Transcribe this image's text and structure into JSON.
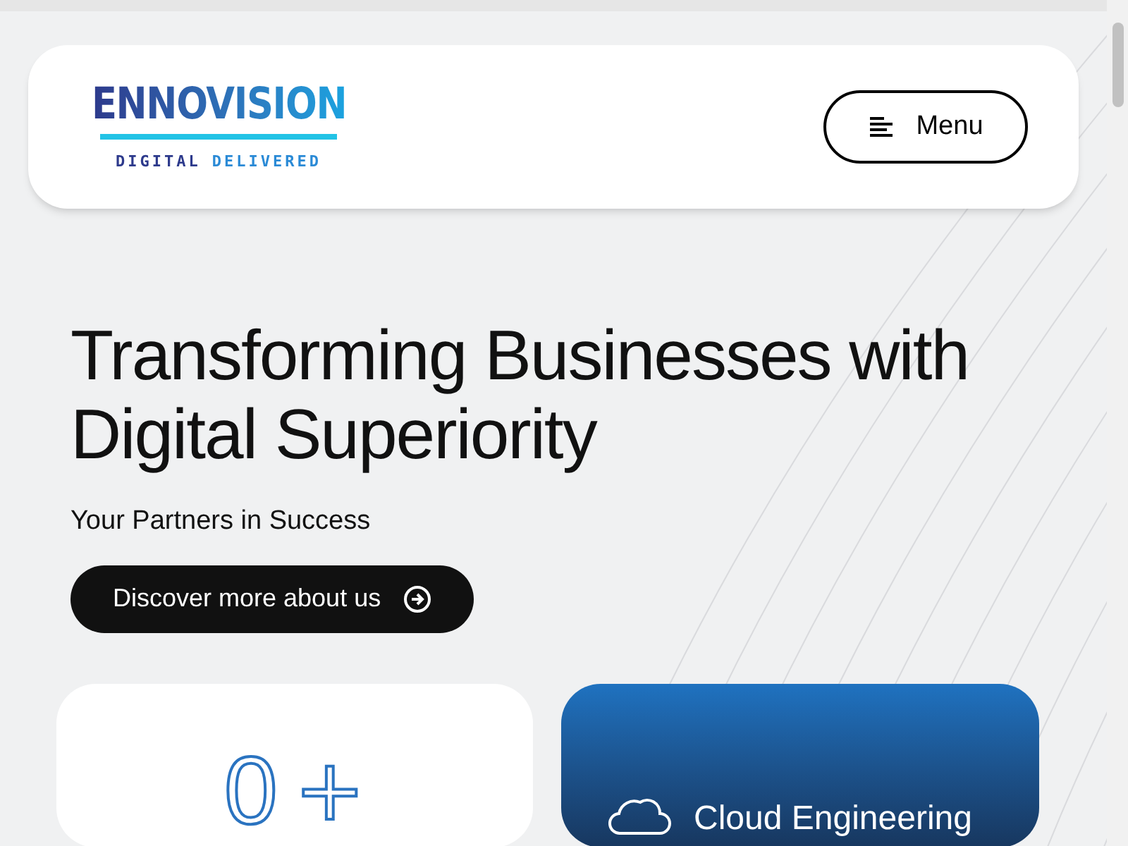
{
  "header": {
    "logo": {
      "name": "ENNOVISION",
      "tagline_1": "DIGITAL",
      "tagline_2": "DELIVERED"
    },
    "menu_button": "Menu"
  },
  "hero": {
    "title": "Transforming Businesses with Digital Superiority",
    "subtitle": "Your Partners in Success",
    "cta": "Discover more about us"
  },
  "cards": [
    {
      "kind": "stat",
      "value": "0",
      "suffix": "+"
    },
    {
      "kind": "service",
      "title": "Cloud Engineering"
    }
  ]
}
